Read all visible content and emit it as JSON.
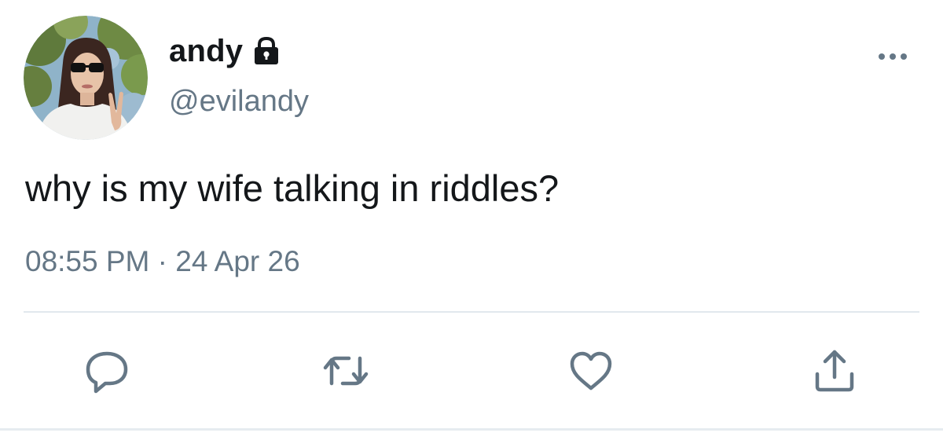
{
  "tweet": {
    "display_name": "andy",
    "handle": "@evilandy",
    "text": "why is my wife talking in riddles?",
    "timestamp": "08:55 PM · 24 Apr 26",
    "protected": true
  },
  "icons": {
    "avatar": "profile-photo",
    "lock": "lock-icon",
    "more": "more-options-icon",
    "reply": "reply-icon",
    "retweet": "retweet-icon",
    "like": "heart-icon",
    "share": "share-icon"
  },
  "colors": {
    "primary_text": "#14171a",
    "secondary_text": "#657786",
    "divider": "#e1e8ed",
    "background": "#ffffff"
  }
}
